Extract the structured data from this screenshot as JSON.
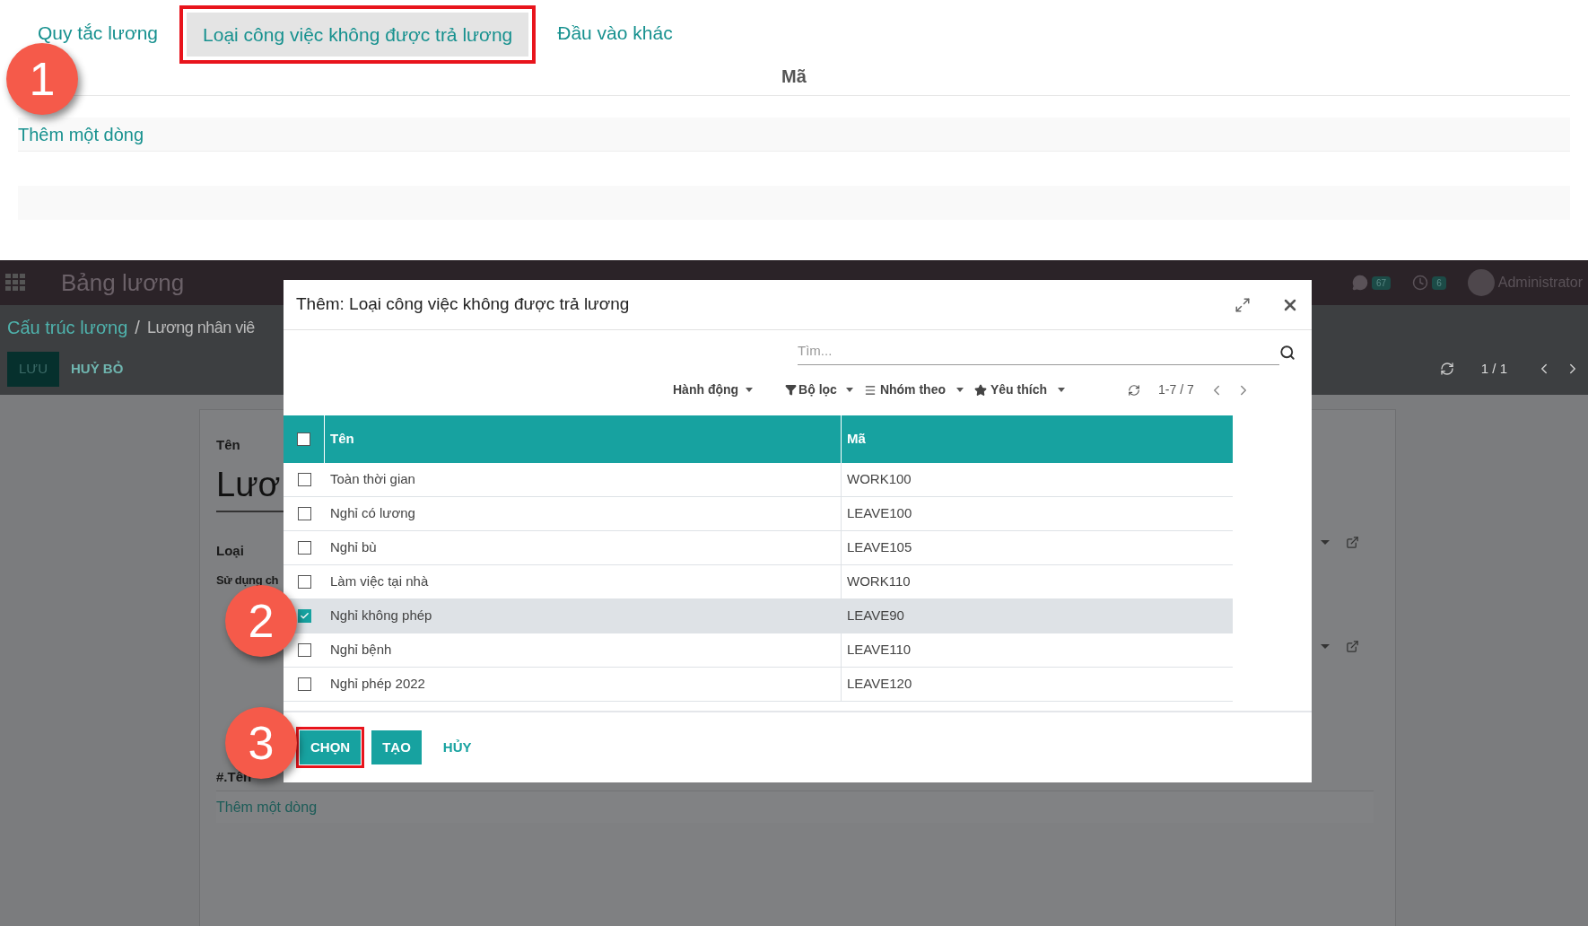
{
  "top_panel": {
    "tabs": [
      {
        "label": "Quy tắc lương",
        "selected": false,
        "highlighted": false
      },
      {
        "label": "Loại công việc không được trả lương",
        "selected": true,
        "highlighted": true
      },
      {
        "label": "Đầu vào khác",
        "selected": false,
        "highlighted": false
      }
    ],
    "column": "Mã",
    "add_line": "Thêm một dòng"
  },
  "navbar": {
    "app_title": "Bảng lương",
    "messages_count": "67",
    "activities_count": "6",
    "user": "Administrator"
  },
  "control_panel": {
    "breadcrumb": [
      "Cấu trúc lương",
      "Lương nhân viê"
    ],
    "separator": "/",
    "buttons": [
      "LƯU",
      "HUỶ BỎ"
    ],
    "pager": "1 / 1"
  },
  "form": {
    "name_label": "Tên",
    "name_value": "Lươ",
    "type_label": "Loại",
    "use_label": "Sử dụng ch",
    "lines_column": "#.Tên",
    "add_line": "Thêm một dòng"
  },
  "dialog": {
    "title": "Thêm: Loại công việc không được trả lương",
    "search": {
      "placeholder": "Tìm..."
    },
    "toolbar": {
      "action": "Hành động",
      "filter": "Bộ lọc",
      "group": "Nhóm theo",
      "favorites": "Yêu thích",
      "pager": "1-7 / 7"
    },
    "columns": [
      "Tên",
      "Mã"
    ],
    "all_checked": false,
    "rows": [
      {
        "name": "Toàn thời gian",
        "code": "WORK100",
        "checked": false
      },
      {
        "name": "Nghỉ có lương",
        "code": "LEAVE100",
        "checked": false
      },
      {
        "name": "Nghỉ bù",
        "code": "LEAVE105",
        "checked": false
      },
      {
        "name": "Làm việc tại nhà",
        "code": "WORK110",
        "checked": false
      },
      {
        "name": "Nghỉ không phép",
        "code": "LEAVE90",
        "checked": true
      },
      {
        "name": "Nghỉ bệnh",
        "code": "LEAVE110",
        "checked": false
      },
      {
        "name": "Nghỉ phép 2022",
        "code": "LEAVE120",
        "checked": false
      }
    ],
    "buttons": [
      {
        "label": "CHỌN",
        "kind": "primary",
        "highlighted": true
      },
      {
        "label": "TẠO",
        "kind": "primary",
        "highlighted": false
      },
      {
        "label": "HỦY",
        "kind": "link",
        "highlighted": false
      }
    ]
  },
  "callouts": [
    {
      "label": "1"
    },
    {
      "label": "2"
    },
    {
      "label": "3"
    }
  ]
}
